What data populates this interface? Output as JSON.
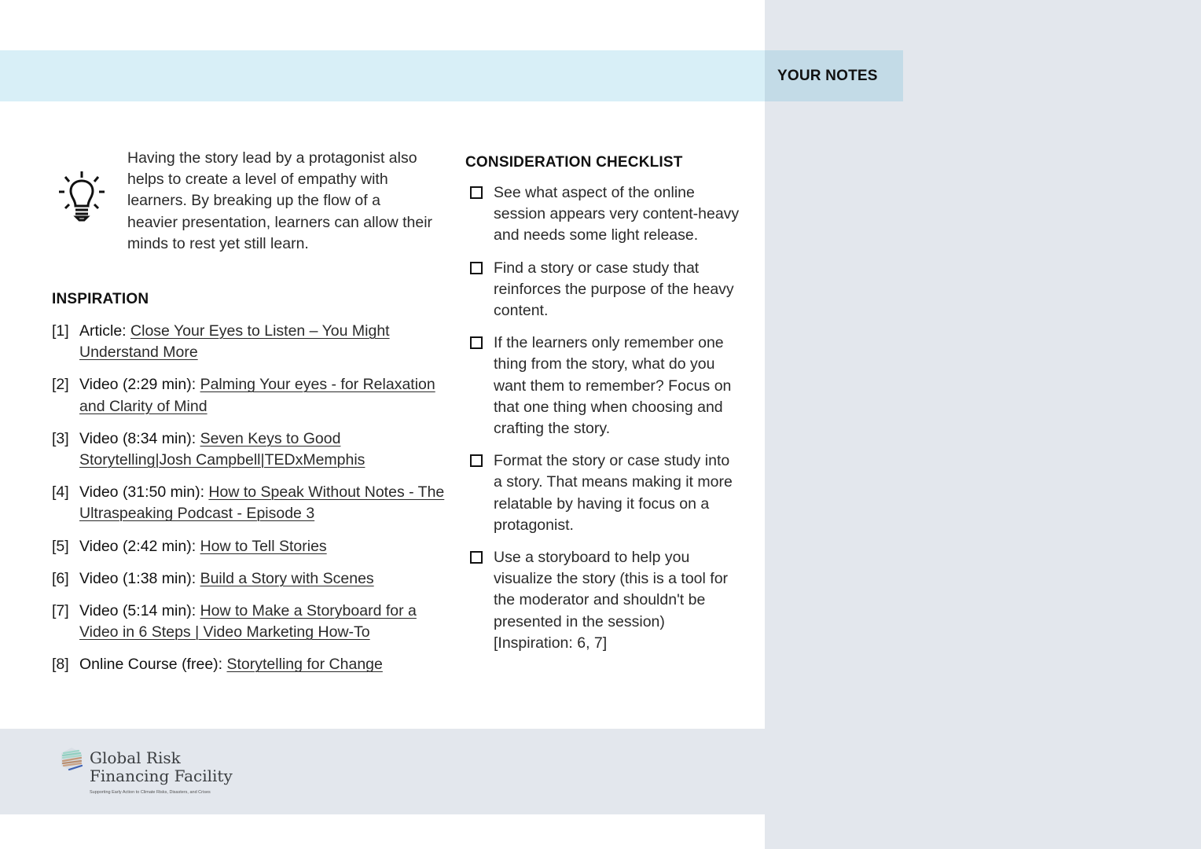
{
  "notes_panel": {
    "title": "YOUR NOTES"
  },
  "intro": {
    "icon": "lightbulb-icon",
    "text": "Having the story lead by a protagonist also helps to create a level of empathy with learners. By breaking up the flow of a heavier presentation, learners can allow their minds to rest yet still learn."
  },
  "inspiration": {
    "title": "INSPIRATION",
    "items": [
      {
        "num": "[1]",
        "label": "Article:",
        "link": "Close Your Eyes to Listen – You Might Understand More"
      },
      {
        "num": "[2]",
        "label": "Video (2:29 min):",
        "link": "Palming Your eyes - for Relaxation and Clarity of Mind"
      },
      {
        "num": "[3]",
        "label": "Video (8:34 min):",
        "link": "Seven Keys to Good Storytelling|Josh Campbell|TEDxMemphis"
      },
      {
        "num": "[4]",
        "label": "Video (31:50 min):",
        "link": "How to Speak Without Notes - The Ultraspeaking Podcast - Episode 3"
      },
      {
        "num": "[5]",
        "label": "Video (2:42 min):",
        "link": "How to Tell Stories"
      },
      {
        "num": "[6]",
        "label": "Video (1:38 min):",
        "link": "Build a Story with Scenes"
      },
      {
        "num": "[7]",
        "label": "Video (5:14 min):",
        "link": "How to Make a Storyboard for a Video in 6 Steps | Video Marketing How-To"
      },
      {
        "num": "[8]",
        "label": "Online Course (free):",
        "link": "Storytelling for Change"
      }
    ]
  },
  "checklist": {
    "title": "CONSIDERATION CHECKLIST",
    "items": [
      {
        "checked": false,
        "text": "See what aspect of the online session appears very content-heavy and needs some light release."
      },
      {
        "checked": false,
        "text": "Find a story or case study that reinforces the purpose of the heavy content."
      },
      {
        "checked": false,
        "text": "If the learners only remember one thing from the story, what do you want them to remember? Focus on that one thing when choosing and crafting the story."
      },
      {
        "checked": false,
        "text": "Format the story or case study into a story. That means making it more relatable by having it focus on a protagonist."
      },
      {
        "checked": false,
        "text": "Use a storyboard to help you visualize the story (this is a tool for the moderator and shouldn't be presented in the session) [Inspiration: 6, 7]"
      }
    ]
  },
  "footer": {
    "logo_line1": "Global Risk",
    "logo_line2": "Financing Facility",
    "tagline": "Supporting Early Action to Climate Risks, Disasters, and Crises"
  },
  "colors": {
    "header_band": "#d8eff7",
    "notes_tab": "#c3dbe7",
    "panel_gray": "#e3e7ed"
  }
}
